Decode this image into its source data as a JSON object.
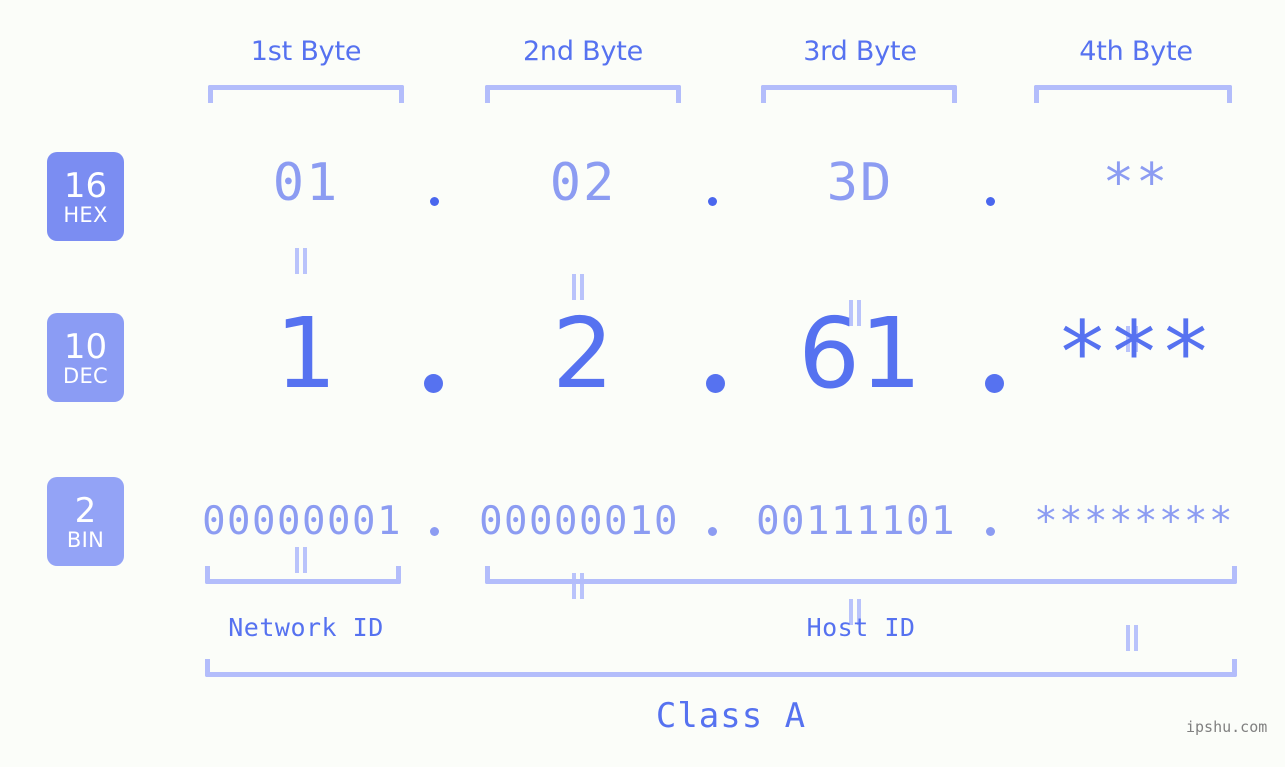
{
  "meta": {
    "background_color": "#fbfdf9",
    "accent_strong": "#5672f0",
    "accent_light": "#8c9cf2",
    "accent_bracket": "#b3bdfb",
    "watermark": "ipshu.com"
  },
  "byte_headers": [
    {
      "label": "1st Byte"
    },
    {
      "label": "2nd Byte"
    },
    {
      "label": "3rd Byte"
    },
    {
      "label": "4th Byte"
    }
  ],
  "rows": [
    {
      "badge": {
        "number": "16",
        "abbr": "HEX",
        "color": "#7b8df2"
      },
      "values": [
        "01",
        "02",
        "3D",
        "**"
      ],
      "separator": "."
    },
    {
      "badge": {
        "number": "10",
        "abbr": "DEC",
        "color": "#8b9cf4"
      },
      "values": [
        "1",
        "2",
        "61",
        "***"
      ],
      "separator": "."
    },
    {
      "badge": {
        "number": "2",
        "abbr": "BIN",
        "color": "#93a3f6"
      },
      "values": [
        "00000001",
        "00000010",
        "00111101",
        "********"
      ],
      "separator": "."
    }
  ],
  "equals_symbol": "=",
  "regions": [
    {
      "label": "Network ID"
    },
    {
      "label": "Host ID"
    }
  ],
  "class": {
    "label": "Class A"
  }
}
